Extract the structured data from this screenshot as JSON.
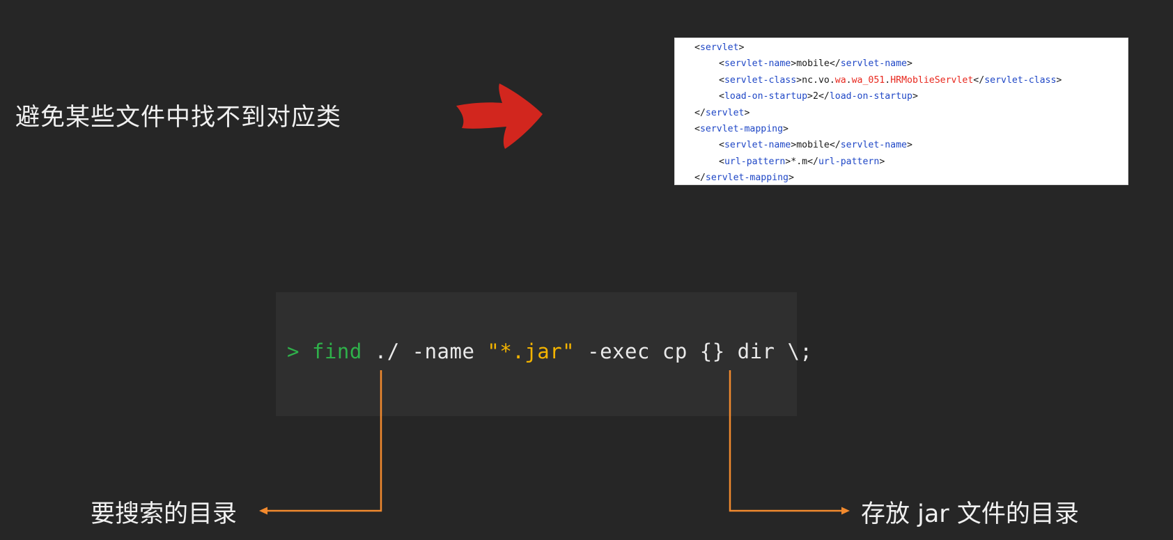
{
  "headline": "避免某些文件中找不到对应类",
  "arrow_color": "#d2261e",
  "xml": {
    "line1_open": "<",
    "line1_tag": "servlet",
    "line1_close": ">",
    "line2_lt": "<",
    "line2_tag": "servlet-name",
    "line2_gt": ">",
    "line2_text": "mobile",
    "line2_lt2": "</",
    "line2_tag2": "servlet-name",
    "line2_gt2": ">",
    "line3_lt": "<",
    "line3_tag": "servlet-class",
    "line3_gt": ">",
    "line3_text_a": "nc.vo.",
    "line3_red_a": "wa",
    "line3_dot1": ".",
    "line3_red_b": "wa_051",
    "line3_dot2": ".",
    "line3_red_c": "HRMoblieServlet",
    "line3_lt2": "</",
    "line3_tag2": "servlet-class",
    "line3_gt2": ">",
    "line4_lt": "<",
    "line4_tag": "load-on-startup",
    "line4_gt": ">",
    "line4_text": "2",
    "line4_lt2": "</",
    "line4_tag2": "load-on-startup",
    "line4_gt2": ">",
    "line5_lt": "</",
    "line5_tag": "servlet",
    "line5_gt": ">",
    "line6_lt": "<",
    "line6_tag": "servlet-mapping",
    "line6_gt": ">",
    "line7_lt": "<",
    "line7_tag": "servlet-name",
    "line7_gt": ">",
    "line7_text": "mobile",
    "line7_lt2": "</",
    "line7_tag2": "servlet-name",
    "line7_gt2": ">",
    "line8_lt": "<",
    "line8_tag": "url-pattern",
    "line8_gt": ">",
    "line8_text": "*.m",
    "line8_lt2": "</",
    "line8_tag2": "url-pattern",
    "line8_gt2": ">",
    "line9_lt": "</",
    "line9_tag": "servlet-mapping",
    "line9_gt": ">"
  },
  "command": {
    "prompt": ">",
    "find": "find",
    "path": "./",
    "name_flag": "-name",
    "pattern": "\"*.jar\"",
    "rest": "-exec cp {} dir \\;"
  },
  "labels": {
    "left": "要搜索的目录",
    "right": "存放 jar 文件的目录"
  },
  "connector_color": "#f28a2e"
}
